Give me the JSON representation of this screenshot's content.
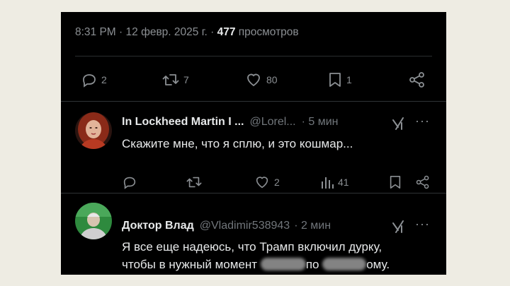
{
  "tweet": {
    "time": "8:31 PM",
    "date": "12 февр. 2025 г.",
    "dot": "·",
    "views_count": "477",
    "views_label": "просмотров",
    "stats": {
      "replies": "2",
      "retweets": "7",
      "likes": "80",
      "bookmarks": "1"
    }
  },
  "replies": [
    {
      "name": "In Lockheed Martin I ...",
      "handle": "@Lorel...",
      "time": "· 5 мин",
      "text": "Скажите мне, что я сплю, и это кошмар...",
      "stats": {
        "replies": "",
        "retweets": "",
        "likes": "2",
        "views": "41"
      }
    },
    {
      "name": "Доктор Влад",
      "handle": "@Vladimir538943",
      "time": "· 2 мин",
      "text_line1": "Я все еще надеюсь, что Трамп включил дурку,",
      "text_line2_a": "чтобы в нужный момент",
      "text_line2_b": "по",
      "text_line2_c": "ому."
    }
  ],
  "icons": {
    "reply": "reply-icon",
    "retweet": "retweet-icon",
    "like": "heart-icon",
    "bookmark": "bookmark-icon",
    "share": "share-icon",
    "views": "views-icon",
    "grok": "grok-icon",
    "more": "more-icon"
  },
  "colors": {
    "background": "#000000",
    "text": "#e7e9ea",
    "muted": "#8b8f93",
    "page": "#eeece3"
  }
}
